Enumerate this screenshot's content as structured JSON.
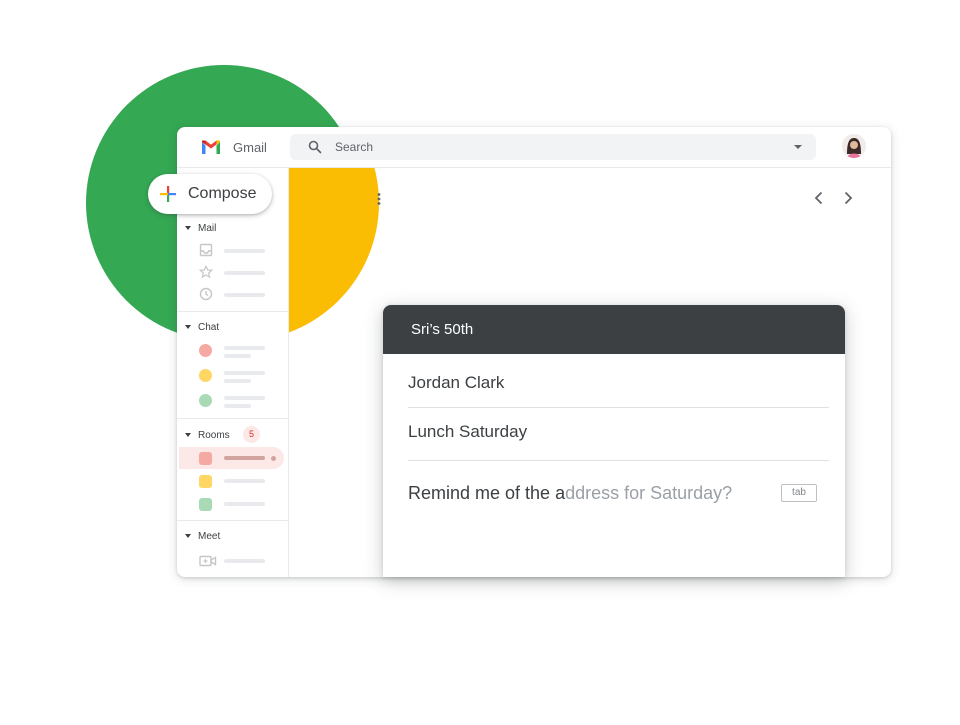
{
  "app": {
    "name": "Gmail",
    "search": {
      "placeholder": "Search"
    },
    "compose_label": "Compose"
  },
  "sidebar": {
    "sections": [
      {
        "label": "Mail",
        "items": [
          "inbox-icon",
          "star-icon",
          "clock-icon"
        ]
      },
      {
        "label": "Chat",
        "items": [
          "chat-avatar-red",
          "chat-avatar-yellow",
          "chat-avatar-green"
        ]
      },
      {
        "label": "Rooms",
        "badge": "5",
        "items": [
          "room-red",
          "room-yellow",
          "room-green"
        ]
      },
      {
        "label": "Meet",
        "items": [
          "video-camera-icon"
        ]
      }
    ]
  },
  "compose_card": {
    "title": "Sri’s 50th",
    "to": "Jordan Clark",
    "subject": "Lunch Saturday",
    "body_typed": "Remind me of the a",
    "body_suggestion": "ddress for Saturday?",
    "tab_hint": "tab"
  },
  "colors": {
    "green": "#34a853",
    "yellow": "#fbbc04",
    "red": "#ea4335",
    "blue": "#4285f4",
    "card_header": "#3c4043"
  }
}
